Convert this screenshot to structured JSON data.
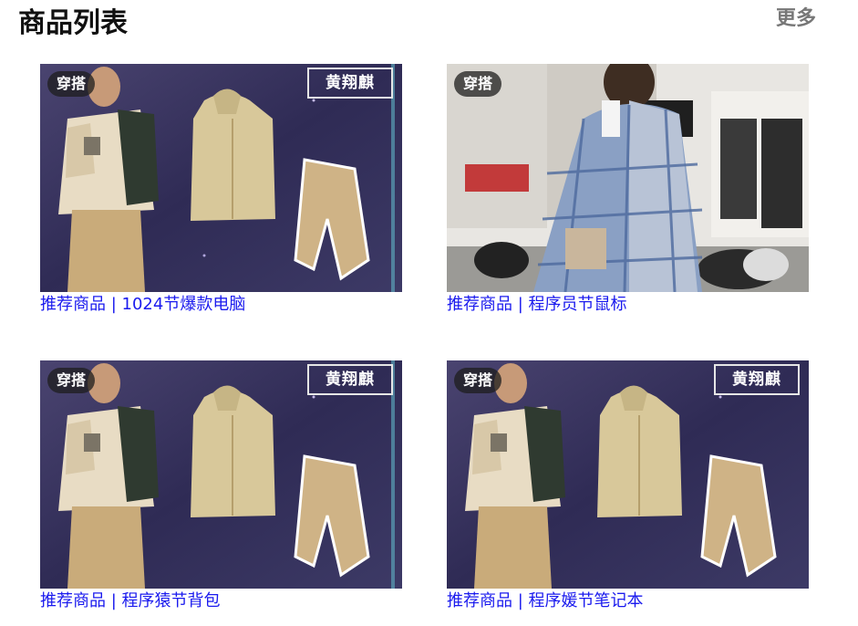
{
  "header": {
    "title": "商品列表",
    "more_label": "更多"
  },
  "products": [
    {
      "tag": "穿搭",
      "brand": "黄翔麒",
      "caption": "推荐商品 | 1024节爆款电脑",
      "image_kind": "outfit-set"
    },
    {
      "tag": "穿搭",
      "caption": "推荐商品 | 程序员节鼠标",
      "image_kind": "street-coat"
    },
    {
      "tag": "穿搭",
      "brand": "黄翔麒",
      "caption": "推荐商品 | 程序猿节背包",
      "image_kind": "outfit-set"
    },
    {
      "tag": "穿搭",
      "brand": "黄翔麒",
      "caption": "推荐商品 | 程序媛节笔记本",
      "image_kind": "outfit-set"
    }
  ],
  "colors": {
    "caption_link": "#1a1aee",
    "more_link": "#777777",
    "title": "#111111",
    "outfit_bg": "#3a3560",
    "khaki": "#cdb48a"
  }
}
